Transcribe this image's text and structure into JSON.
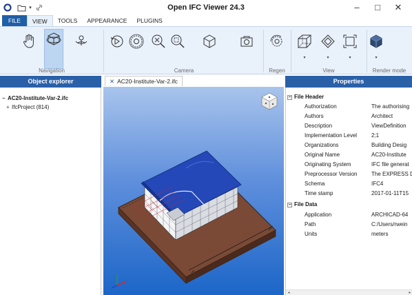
{
  "window": {
    "title": "Open IFC Viewer 24.3",
    "minimize": "–",
    "maximize": "□",
    "close": "✕"
  },
  "tabs": [
    "FILE",
    "VIEW",
    "TOOLS",
    "APPEARANCE",
    "PLUGINS"
  ],
  "active_tab": "VIEW",
  "ribbon": {
    "groups": [
      "Navigation",
      "Camera",
      "Regen",
      "View",
      "Render mode"
    ]
  },
  "object_explorer": {
    "title": "Object explorer",
    "root": "AC20-Institute-Var-2.ifc",
    "child": "IfcProject (814)",
    "root_expander": "−",
    "child_expander": "+"
  },
  "document": {
    "tab_label": "AC20-Institute-Var-2.ifc",
    "close_glyph": "✕"
  },
  "properties": {
    "title": "Properties",
    "categories": [
      {
        "name": "File Header",
        "rows": [
          {
            "key": "Authorization",
            "value": "The authorising"
          },
          {
            "key": "Authors",
            "value": "Architect"
          },
          {
            "key": "Description",
            "value": "ViewDefinition"
          },
          {
            "key": "Implementation Level",
            "value": "2;1"
          },
          {
            "key": "Organizations",
            "value": "Building Desig"
          },
          {
            "key": "Original Name",
            "value": "AC20-Institute"
          },
          {
            "key": "Originating System",
            "value": "IFC file generat"
          },
          {
            "key": "Preprocessor Version",
            "value": "The EXPRESS D"
          },
          {
            "key": "Schema",
            "value": "IFC4"
          },
          {
            "key": "Time stamp",
            "value": "2017-01-11T15"
          }
        ]
      },
      {
        "name": "File Data",
        "rows": [
          {
            "key": "Application",
            "value": "ARCHICAD-64"
          },
          {
            "key": "Path",
            "value": "C:/Users/rwein"
          },
          {
            "key": "Units",
            "value": "meters"
          }
        ]
      }
    ]
  },
  "colors": {
    "accent": "#2a60a8",
    "ribbon_bg": "#e9f1fb",
    "viewport_top": "#a8c4ec",
    "viewport_bottom": "#1c66c8",
    "roof": "#2448b8",
    "ground": "#7a4a36"
  },
  "icons": [
    "app-logo-icon",
    "folder-icon",
    "dropdown-icon",
    "link-icon",
    "pan-hand-icon",
    "orbit-icon",
    "walk-icon",
    "rotate-left-icon",
    "settings-view-icon",
    "zoom-extents-icon",
    "zoom-window-icon",
    "cube-icon",
    "camera-icon",
    "regen-icon",
    "perspective-cube-icon",
    "diamond-view-icon",
    "frame-icon",
    "render-mode-icon",
    "view-cube-icon",
    "axis-gizmo-icon"
  ]
}
